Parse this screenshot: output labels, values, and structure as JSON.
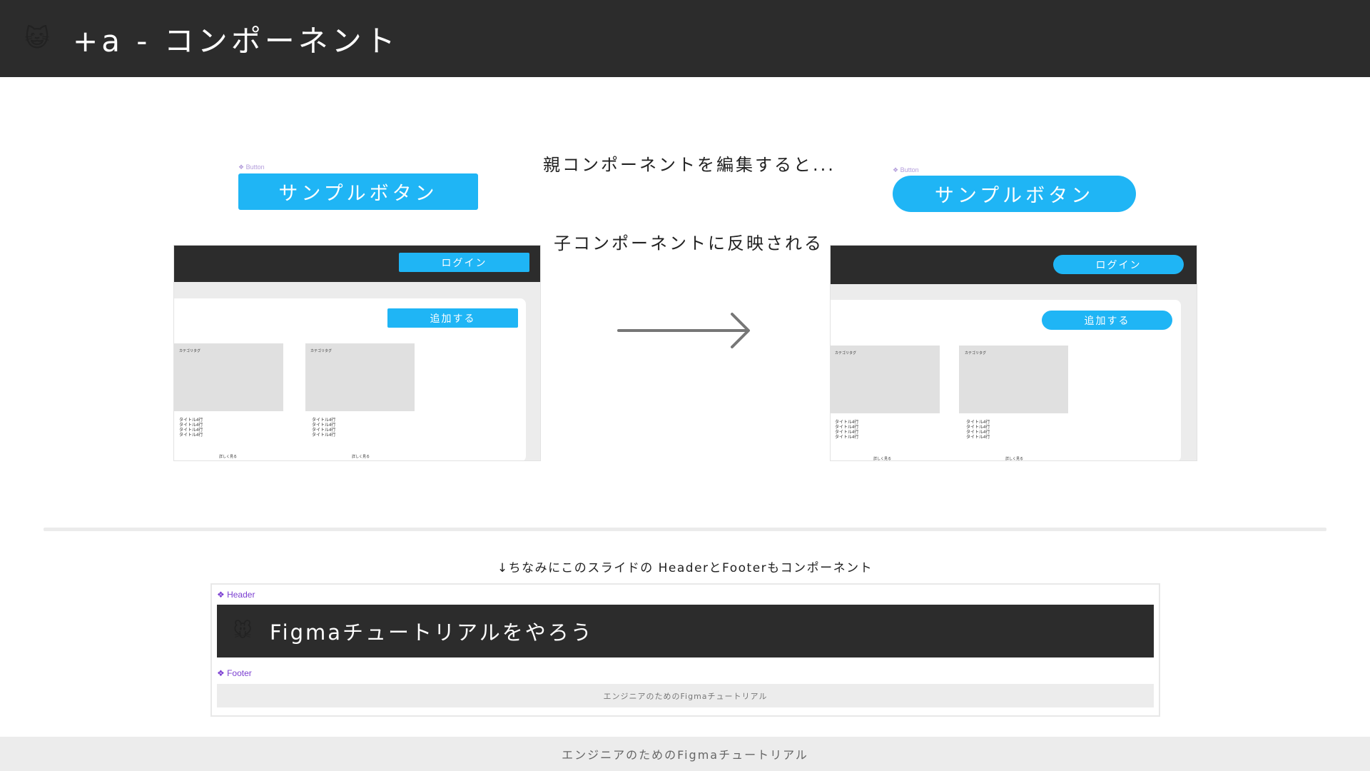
{
  "header": {
    "emoji": "😺",
    "title": "+a - コンポーネント"
  },
  "captions": {
    "edit_parent": "親コンポーネントを編集すると...",
    "reflected": "子コンポーネントに反映される"
  },
  "before": {
    "component_tag": "❖ Button",
    "sample_button": "サンプルボタン",
    "mock": {
      "login": "ログイン",
      "add": "追加する",
      "cards": [
        {
          "category": "カテゴリタグ",
          "lines": [
            "タイトル4行",
            "タイトル4行",
            "タイトル4行",
            "タイトル4行"
          ],
          "more": "詳しく見る"
        },
        {
          "category": "カテゴリタグ",
          "lines": [
            "タイトル4行",
            "タイトル4行",
            "タイトル4行",
            "タイトル4行"
          ],
          "more": "詳しく見る"
        }
      ]
    }
  },
  "after": {
    "component_tag": "❖ Button",
    "sample_button": "サンプルボタン",
    "mock": {
      "login": "ログイン",
      "add": "追加する",
      "cards": [
        {
          "category": "カテゴリタグ",
          "lines": [
            "タイトル4行",
            "タイトル4行",
            "タイトル4行",
            "タイトル4行"
          ],
          "more": "詳しく見る"
        },
        {
          "category": "カテゴリタグ",
          "lines": [
            "タイトル4行",
            "タイトル4行",
            "タイトル4行",
            "タイトル4行"
          ],
          "more": "詳しく見る"
        }
      ]
    }
  },
  "note": "↓ちなみにこのスライドの HeaderとFooterもコンポーネント",
  "example": {
    "header_tag": "❖ Header",
    "header_emoji": "🐭",
    "header_title": "Figmaチュートリアルをやろう",
    "footer_tag": "❖ Footer",
    "footer_text": "エンジニアのためのFigmaチュートリアル"
  },
  "footer": {
    "text": "エンジニアのためのFigmaチュートリアル"
  },
  "colors": {
    "dark": "#2c2c2c",
    "accent": "#1fb5f5",
    "tag_purple": "#7b3fd1"
  }
}
